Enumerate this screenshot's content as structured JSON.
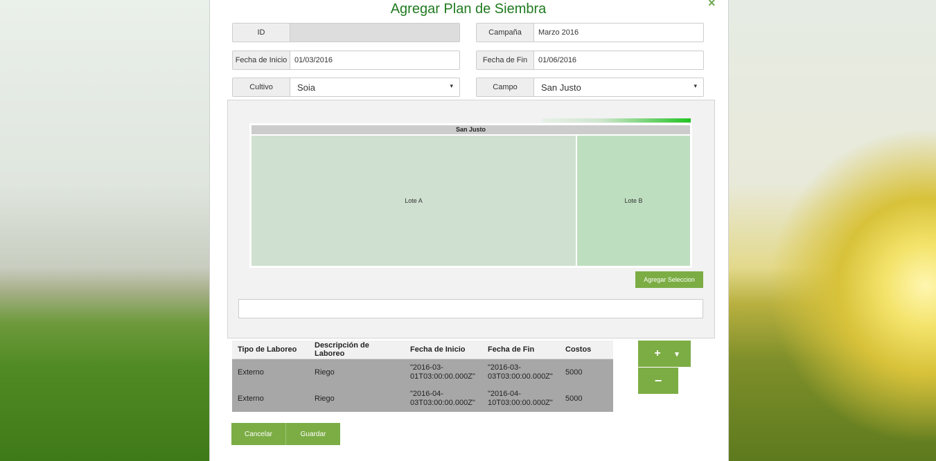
{
  "title": "Agregar Plan de Siembra",
  "close_icon": "×",
  "fields": {
    "id": {
      "label": "ID",
      "value": ""
    },
    "campana": {
      "label": "Campaña",
      "value": "Marzo 2016"
    },
    "fecha_inicio": {
      "label": "Fecha de Inicio",
      "value": "01/03/2016"
    },
    "fecha_fin": {
      "label": "Fecha de Fin",
      "value": "01/06/2016"
    },
    "cultivo": {
      "label": "Cultivo",
      "value": "Soia"
    },
    "campo": {
      "label": "Campo",
      "value": "San Justo"
    }
  },
  "map": {
    "header": "San Justo",
    "lotes": [
      "Lote A",
      "Lote B"
    ]
  },
  "add_selection_label": "Agregar Seleccion",
  "table": {
    "headers": [
      "Tipo de Laboreo",
      "Descripción de Laboreo",
      "Fecha de Inicio",
      "Fecha de Fin",
      "Costos"
    ],
    "rows": [
      {
        "tipo": "Externo",
        "descripcion": "Riego",
        "inicio_a": "\"2016-03-",
        "inicio_b": "01T03:00:00.000Z\"",
        "fin_a": "\"2016-03-",
        "fin_b": "03T03:00:00.000Z\"",
        "costo": "5000"
      },
      {
        "tipo": "Externo",
        "descripcion": "Riego",
        "inicio_a": "\"2016-04-",
        "inicio_b": "03T03:00:00.000Z\"",
        "fin_a": "\"2016-04-",
        "fin_b": "10T03:00:00.000Z\"",
        "costo": "5000"
      }
    ]
  },
  "buttons": {
    "add": "+",
    "dropdown": "▾",
    "remove": "−",
    "cancel": "Cancelar",
    "save": "Guardar"
  },
  "colors": {
    "accent": "#7cad45",
    "title": "#1f7a1f"
  }
}
